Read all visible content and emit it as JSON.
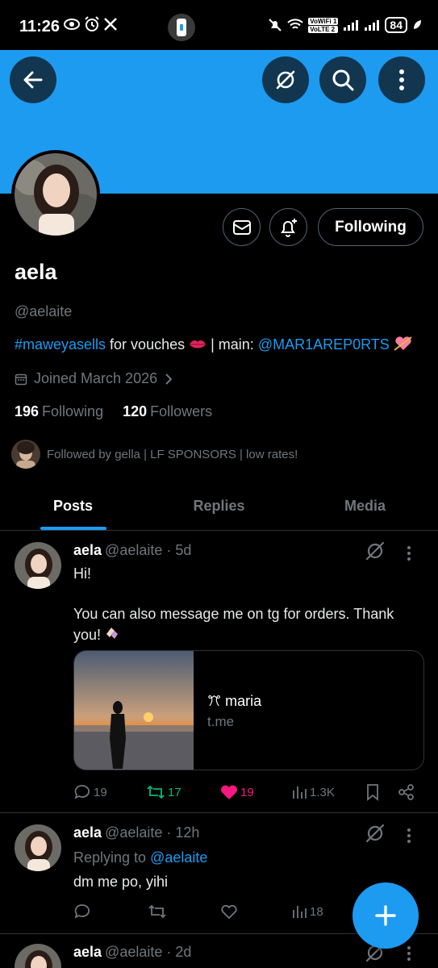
{
  "status_bar": {
    "time": "11:26",
    "volte_1": "VoWiFi 1",
    "volte_2": "VoLTE 2",
    "battery": "84"
  },
  "header": {
    "icons": [
      "back-arrow-icon",
      "grok-icon",
      "search-icon",
      "more-vertical-icon"
    ],
    "banner_color": "#1d9bf0"
  },
  "profile": {
    "name": "aela",
    "handle": "@aelaite",
    "bio": {
      "hashtag": "#maweyasells",
      "text_1": " for vouches ",
      "text_2": " | main: ",
      "mention": "@MAR1AREP0RTS"
    },
    "joined": "Joined March 2026",
    "following_count": "196",
    "following_label": "Following",
    "followers_count": "120",
    "followers_label": "Followers",
    "followed_by": "Followed by gella | LF SPONSORS | low rates!",
    "following_button": "Following"
  },
  "tabs": [
    {
      "label": "Posts",
      "active": true
    },
    {
      "label": "Replies",
      "active": false
    },
    {
      "label": "Media",
      "active": false
    }
  ],
  "posts": [
    {
      "name": "aela",
      "handle": "@aelaite",
      "time": "· 5d",
      "text_1": "Hi!",
      "text_2": "You can also message me on tg for orders. Thank you!",
      "card": {
        "title": "ꔫ maria",
        "domain": "t.me"
      },
      "replies": "19",
      "reposts": "17",
      "likes": "19",
      "views": "1.3K"
    },
    {
      "name": "aela",
      "handle": "@aelaite",
      "time": "· 12h",
      "replying_label": "Replying to",
      "replying_to": "@aelaite",
      "text_1": "dm me po, yihi",
      "views": "18"
    },
    {
      "name": "aela",
      "handle": "@aelaite",
      "time": "· 2d"
    }
  ],
  "colors": {
    "accent": "#1d9bf0",
    "repost": "#00ba7c",
    "like": "#f91880",
    "muted": "#71767b"
  }
}
